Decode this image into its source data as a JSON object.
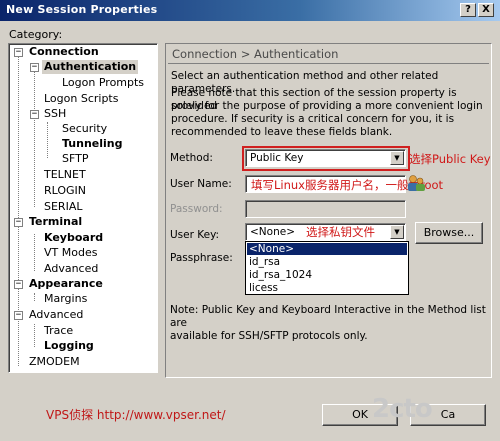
{
  "window": {
    "title": "New Session Properties",
    "help_btn": "?",
    "close_btn": "X"
  },
  "category_label": "Category:",
  "tree": {
    "connection": "Connection",
    "authentication": "Authentication",
    "logon_prompts": "Logon Prompts",
    "logon_scripts": "Logon Scripts",
    "ssh": "SSH",
    "security": "Security",
    "tunneling": "Tunneling",
    "sftp": "SFTP",
    "telnet": "TELNET",
    "rlogin": "RLOGIN",
    "serial": "SERIAL",
    "terminal": "Terminal",
    "keyboard": "Keyboard",
    "vt_modes": "VT Modes",
    "advanced_t": "Advanced",
    "appearance": "Appearance",
    "margins": "Margins",
    "advanced": "Advanced",
    "trace": "Trace",
    "logging": "Logging",
    "zmodem": "ZMODEM"
  },
  "panel": {
    "header": "Connection > Authentication",
    "intro": "Select an authentication method and other related parameters.",
    "note_lines": [
      "Please note that this section of the session property is provided",
      "solely for the purpose of providing a more convenient login",
      "procedure. If security is a critical concern for you, it is",
      "recommended to leave these fields blank."
    ],
    "method_label": "Method:",
    "method_value": "Public Key",
    "username_label": "User Name:",
    "username_value": "",
    "password_label": "Password:",
    "userkey_label": "User Key:",
    "userkey_value": "<None>",
    "browse_label": "Browse...",
    "passphrase_label": "Passphrase:",
    "dropdown_options": [
      "<None>",
      "id_rsa",
      "id_rsa_1024",
      "licess"
    ],
    "footnote_lines": [
      "Note: Public Key and Keyboard Interactive in the Method list are",
      "available for SSH/SFTP protocols only."
    ]
  },
  "annotations": {
    "method": "选择Public Key",
    "username": "填写Linux服务器用户名，一般为root",
    "userkey": "选择私钥文件"
  },
  "buttons": {
    "ok": "OK",
    "cancel": "Ca"
  },
  "footer": "VPS侦探 http://www.vpser.net/",
  "watermark": "2cto",
  "colors": {
    "title_start": "#0a246a",
    "title_end": "#a6caf0",
    "annotation": "#d01818",
    "selection": "#0a246a"
  }
}
